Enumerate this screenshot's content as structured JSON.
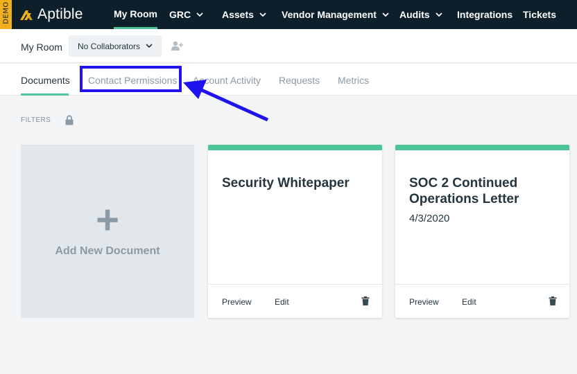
{
  "topnav": {
    "demo_label": "DEMO",
    "logo_text": "Aptible",
    "items": [
      {
        "label": "My Room",
        "dropdown": false,
        "active": true
      },
      {
        "label": "GRC",
        "dropdown": true,
        "active": false
      },
      {
        "label": "Assets",
        "dropdown": true,
        "active": false
      },
      {
        "label": "Vendor Management",
        "dropdown": true,
        "active": false
      },
      {
        "label": "Audits",
        "dropdown": true,
        "active": false
      },
      {
        "label": "Integrations",
        "dropdown": false,
        "active": false
      },
      {
        "label": "Tickets",
        "dropdown": false,
        "active": false
      }
    ]
  },
  "subheader": {
    "room_label": "My Room",
    "collaborators_label": "No Collaborators"
  },
  "tabs": [
    {
      "label": "Documents",
      "active": true
    },
    {
      "label": "Contact Permissions",
      "active": false
    },
    {
      "label": "Account Activity",
      "active": false
    },
    {
      "label": "Requests",
      "active": false
    },
    {
      "label": "Metrics",
      "active": false
    }
  ],
  "filters": {
    "label": "FILTERS"
  },
  "add_document": {
    "label": "Add New Document"
  },
  "cards": [
    {
      "title": "Security Whitepaper",
      "date": "",
      "preview_label": "Preview",
      "edit_label": "Edit"
    },
    {
      "title": "SOC 2 Continued Operations Letter",
      "date": "4/3/2020",
      "preview_label": "Preview",
      "edit_label": "Edit"
    }
  ],
  "colors": {
    "accent": "#4cc497",
    "nav_bg": "#0c1f2b",
    "annotation": "#1f14f0",
    "demo": "#f2b01e"
  }
}
